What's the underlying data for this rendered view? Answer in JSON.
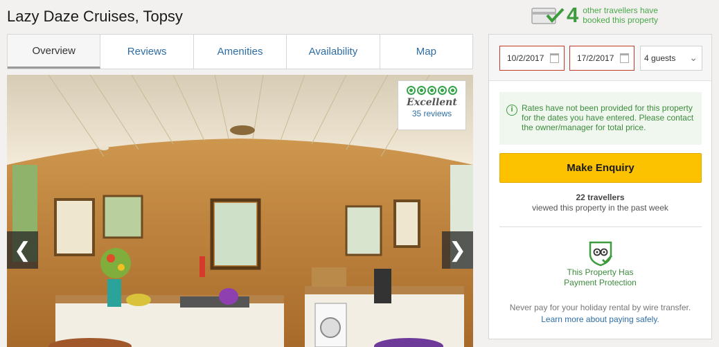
{
  "header": {
    "title": "Lazy Daze Cruises, Topsy",
    "booked_count": "4",
    "booked_text_1": "other travellers have",
    "booked_text_2": "booked this property"
  },
  "tabs": [
    {
      "label": "Overview",
      "active": true
    },
    {
      "label": "Reviews",
      "active": false
    },
    {
      "label": "Amenities",
      "active": false
    },
    {
      "label": "Availability",
      "active": false
    },
    {
      "label": "Map",
      "active": false
    }
  ],
  "gallery": {
    "rating_word": "Excellent",
    "reviews": "35 reviews",
    "rating_bubbles": 5,
    "prev_glyph": "❮",
    "next_glyph": "❯"
  },
  "booking": {
    "checkin": "10/2/2017",
    "checkout": "17/2/2017",
    "guests": "4 guests",
    "notice": "Rates have not been provided for this property for the dates you have entered. Please contact the owner/manager for total price.",
    "enquiry_label": "Make Enquiry",
    "viewed_count": "22 travellers",
    "viewed_text": "viewed this property in the past week",
    "protection_1": "This Property Has",
    "protection_2": "Payment Protection",
    "wire_text": "Never pay for your holiday rental by wire transfer.",
    "wire_link": "Learn more about paying safely."
  },
  "colors": {
    "accent_green": "#3d9b3d",
    "link_blue": "#2e6da4",
    "button_yellow": "#fcc200",
    "date_border": "#c0392b"
  }
}
